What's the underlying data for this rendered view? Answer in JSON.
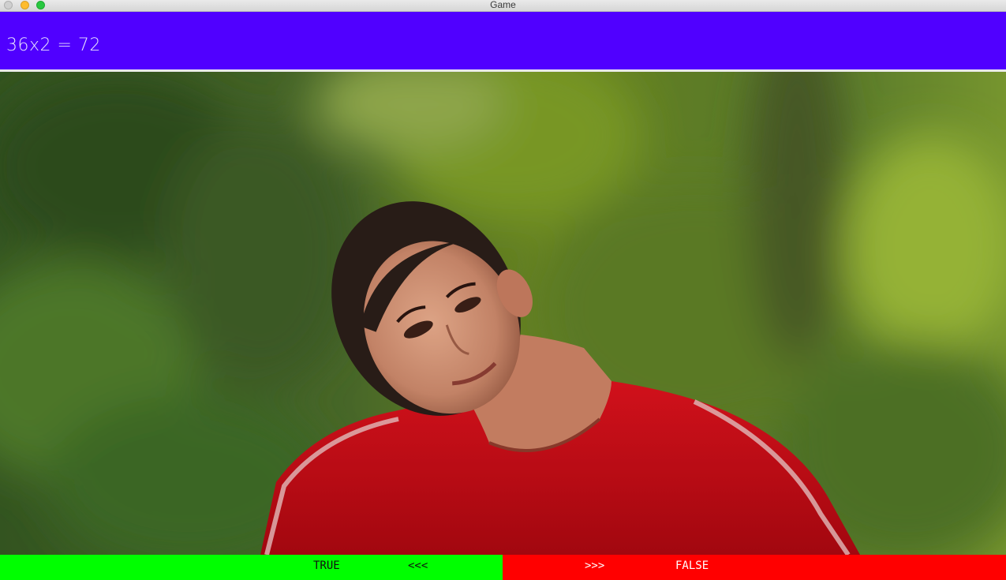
{
  "window": {
    "title": "Game"
  },
  "question": {
    "equation": "36x2 = 72"
  },
  "camera": {
    "feed": "camera-feed",
    "subject": "person tilting head, red t-shirt",
    "background": "blurred green foliage"
  },
  "answers": {
    "true_label": "TRUE",
    "true_arrow": "<<<",
    "false_arrow": ">>>",
    "false_label": "FALSE"
  },
  "colors": {
    "header": "#5000ff",
    "true": "#00ff00",
    "false": "#ff0000"
  }
}
